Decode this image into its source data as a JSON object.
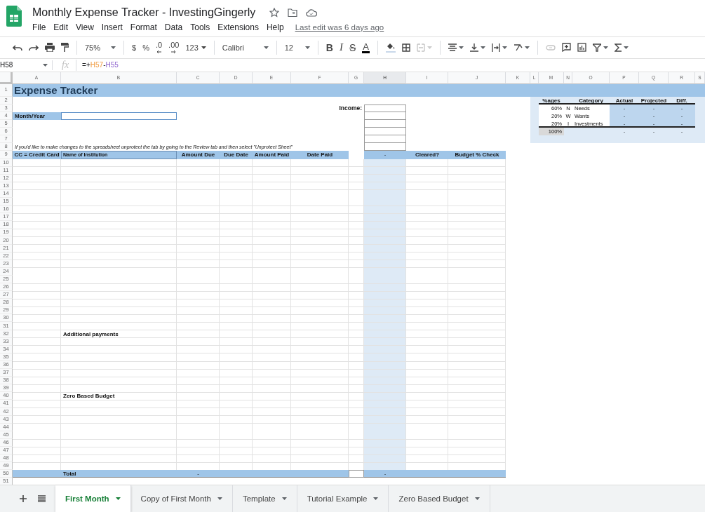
{
  "document": {
    "title": "Monthly Expense Tracker - InvestingGingerly",
    "last_edit": "Last edit was 6 days ago"
  },
  "menu": [
    "File",
    "Edit",
    "View",
    "Insert",
    "Format",
    "Data",
    "Tools",
    "Extensions",
    "Help"
  ],
  "toolbar": [
    {
      "kind": "undo",
      "disabled": false
    },
    {
      "kind": "redo",
      "disabled": false
    },
    {
      "kind": "print",
      "disabled": false
    },
    {
      "kind": "paint",
      "disabled": false
    },
    {
      "kind": "sep"
    },
    {
      "kind": "dropdown",
      "text": "75%",
      "disabled": false
    },
    {
      "kind": "sep"
    },
    {
      "kind": "text",
      "text": "$",
      "disabled": false
    },
    {
      "kind": "text",
      "text": "%",
      "disabled": false
    },
    {
      "kind": "decimal-less",
      "text": ".0",
      "disabled": false
    },
    {
      "kind": "decimal-more",
      "text": ".00",
      "disabled": false
    },
    {
      "kind": "caret-text",
      "text": "123",
      "disabled": false
    },
    {
      "kind": "sep"
    },
    {
      "kind": "dropdown",
      "text": "Calibri",
      "disabled": false
    },
    {
      "kind": "sep"
    },
    {
      "kind": "dropdown",
      "text": "12",
      "disabled": false
    },
    {
      "kind": "sep"
    },
    {
      "kind": "bold",
      "text": "B",
      "disabled": false
    },
    {
      "kind": "italic",
      "text": "I",
      "disabled": false
    },
    {
      "kind": "strike",
      "text": "S",
      "disabled": false
    },
    {
      "kind": "textcolor",
      "text": "A",
      "disabled": false
    },
    {
      "kind": "sep"
    },
    {
      "kind": "fill",
      "disabled": false
    },
    {
      "kind": "borders",
      "disabled": false
    },
    {
      "kind": "merge",
      "disabled": true
    },
    {
      "kind": "sep"
    },
    {
      "kind": "halign",
      "disabled": false
    },
    {
      "kind": "valign",
      "disabled": false
    },
    {
      "kind": "wrap",
      "disabled": false
    },
    {
      "kind": "rotate",
      "disabled": false
    },
    {
      "kind": "sep"
    },
    {
      "kind": "link",
      "disabled": true
    },
    {
      "kind": "comment",
      "disabled": false
    },
    {
      "kind": "chart",
      "disabled": false
    },
    {
      "kind": "filter",
      "disabled": false
    },
    {
      "kind": "sum",
      "disabled": false
    }
  ],
  "formula_bar": {
    "cell": "H58",
    "function_label": "fx",
    "parts": [
      {
        "text": "=+"
      },
      {
        "text": "H57",
        "color": "#f09a3e"
      },
      {
        "text": "-"
      },
      {
        "text": "H55",
        "color": "#8e63ce"
      }
    ]
  },
  "sheet": {
    "columns": [
      {
        "label": "A",
        "selected": false
      },
      {
        "label": "B",
        "selected": false
      },
      {
        "label": "C",
        "selected": false
      },
      {
        "label": "D",
        "selected": false
      },
      {
        "label": "E",
        "selected": false
      },
      {
        "label": "F",
        "selected": false
      },
      {
        "label": "G",
        "selected": false
      },
      {
        "label": "H",
        "selected": true
      },
      {
        "label": "I",
        "selected": false
      },
      {
        "label": "J",
        "selected": false
      },
      {
        "label": "K",
        "selected": false
      },
      {
        "label": "L",
        "selected": false
      },
      {
        "label": "M",
        "selected": false
      },
      {
        "label": "N",
        "selected": false
      },
      {
        "label": "O",
        "selected": false
      },
      {
        "label": "P",
        "selected": false
      },
      {
        "label": "Q",
        "selected": false
      },
      {
        "label": "R",
        "selected": false
      },
      {
        "label": "S",
        "selected": false
      }
    ],
    "rows": [
      {
        "number": "1",
        "cells": {
          "A": {
            "text": "Expense Tracker",
            "kind": "title"
          }
        }
      },
      {
        "number": "2",
        "cells": {
          "M": {
            "text": "%ages",
            "kind": "header"
          },
          "O": {
            "text": "Category",
            "kind": "header"
          },
          "P": {
            "text": "Actual",
            "kind": "header"
          },
          "Q": {
            "text": "Projected",
            "kind": "header"
          },
          "R": {
            "text": "Diff.",
            "kind": "header"
          }
        }
      },
      {
        "number": "3",
        "cells": {
          "G": {
            "text": "Income:",
            "kind": "label-right"
          },
          "M": {
            "text": "60%",
            "kind": "number"
          },
          "N": {
            "text": "N",
            "kind": "center"
          },
          "O": {
            "text": "Needs",
            "kind": "text"
          },
          "P": {
            "text": "-",
            "kind": "center"
          },
          "Q": {
            "text": "-",
            "kind": "center"
          },
          "R": {
            "text": "-",
            "kind": "center"
          }
        }
      },
      {
        "number": "4",
        "cells": {
          "A": {
            "text": "Month/Year",
            "kind": "label"
          },
          "M": {
            "text": "20%",
            "kind": "number"
          },
          "N": {
            "text": "W",
            "kind": "center"
          },
          "O": {
            "text": "Wants",
            "kind": "text"
          },
          "P": {
            "text": "-",
            "kind": "center"
          },
          "Q": {
            "text": "-",
            "kind": "center"
          },
          "R": {
            "text": "-",
            "kind": "center"
          }
        }
      },
      {
        "number": "5",
        "cells": {
          "M": {
            "text": "20%",
            "kind": "number"
          },
          "N": {
            "text": "I",
            "kind": "center"
          },
          "O": {
            "text": "Investments",
            "kind": "text"
          },
          "P": {
            "text": "-",
            "kind": "center"
          },
          "Q": {
            "text": "-",
            "kind": "center"
          },
          "R": {
            "text": "-",
            "kind": "center"
          }
        }
      },
      {
        "number": "6",
        "cells": {
          "M": {
            "text": "100%",
            "kind": "number"
          },
          "P": {
            "text": "-",
            "kind": "center"
          },
          "Q": {
            "text": "-",
            "kind": "center"
          },
          "R": {
            "text": "-",
            "kind": "center"
          }
        }
      },
      {
        "number": "7"
      },
      {
        "number": "8",
        "cells": {
          "A": {
            "text": "If you'd like to make changes to the spreadsheet unprotect the tab by going to the Review tab and then select \"Unprotect Sheet\"",
            "kind": "note"
          }
        }
      },
      {
        "number": "9",
        "cells": {
          "A": {
            "text": "CC = Credit Card",
            "kind": "header"
          },
          "B": {
            "text": "Name of Institution",
            "kind": "small-label"
          },
          "C": {
            "text": "Amount Due",
            "kind": "header"
          },
          "D": {
            "text": "Due Date",
            "kind": "header"
          },
          "E": {
            "text": "Amount Paid",
            "kind": "header"
          },
          "F": {
            "text": "Date Paid",
            "kind": "header"
          },
          "H": {
            "text": "-",
            "kind": "center"
          },
          "I": {
            "text": "Cleared?",
            "kind": "header"
          },
          "J": {
            "text": "Budget % Check",
            "kind": "header"
          }
        }
      },
      {
        "number": "10"
      },
      {
        "number": "11"
      },
      {
        "number": "12"
      },
      {
        "number": "13"
      },
      {
        "number": "14"
      },
      {
        "number": "15"
      },
      {
        "number": "16"
      },
      {
        "number": "17"
      },
      {
        "number": "18"
      },
      {
        "number": "19"
      },
      {
        "number": "20"
      },
      {
        "number": "21"
      },
      {
        "number": "22"
      },
      {
        "number": "23"
      },
      {
        "number": "24"
      },
      {
        "number": "25"
      },
      {
        "number": "26"
      },
      {
        "number": "27"
      },
      {
        "number": "28"
      },
      {
        "number": "29"
      },
      {
        "number": "30"
      },
      {
        "number": "31"
      },
      {
        "number": "32",
        "cells": {
          "B": {
            "text": "Additional payments",
            "kind": "label"
          }
        }
      },
      {
        "number": "33"
      },
      {
        "number": "34"
      },
      {
        "number": "35"
      },
      {
        "number": "36"
      },
      {
        "number": "37"
      },
      {
        "number": "38"
      },
      {
        "number": "39"
      },
      {
        "number": "40",
        "cells": {
          "B": {
            "text": "Zero Based Budget",
            "kind": "label"
          }
        }
      },
      {
        "number": "41"
      },
      {
        "number": "42"
      },
      {
        "number": "43"
      },
      {
        "number": "44"
      },
      {
        "number": "45"
      },
      {
        "number": "46"
      },
      {
        "number": "47"
      },
      {
        "number": "48"
      },
      {
        "number": "49"
      },
      {
        "number": "50",
        "cells": {
          "B": {
            "text": "Total",
            "kind": "label"
          },
          "C": {
            "text": "-",
            "kind": "center"
          },
          "H": {
            "text": "-",
            "kind": "center"
          }
        }
      },
      {
        "number": "51"
      }
    ]
  },
  "sheet_tabs": [
    {
      "label": "First Month",
      "selected": true
    },
    {
      "label": "Copy of First Month",
      "selected": false
    },
    {
      "label": "Template",
      "selected": false
    },
    {
      "label": "Tutorial Example",
      "selected": false
    },
    {
      "label": "Zero Based Budget",
      "selected": false
    }
  ]
}
